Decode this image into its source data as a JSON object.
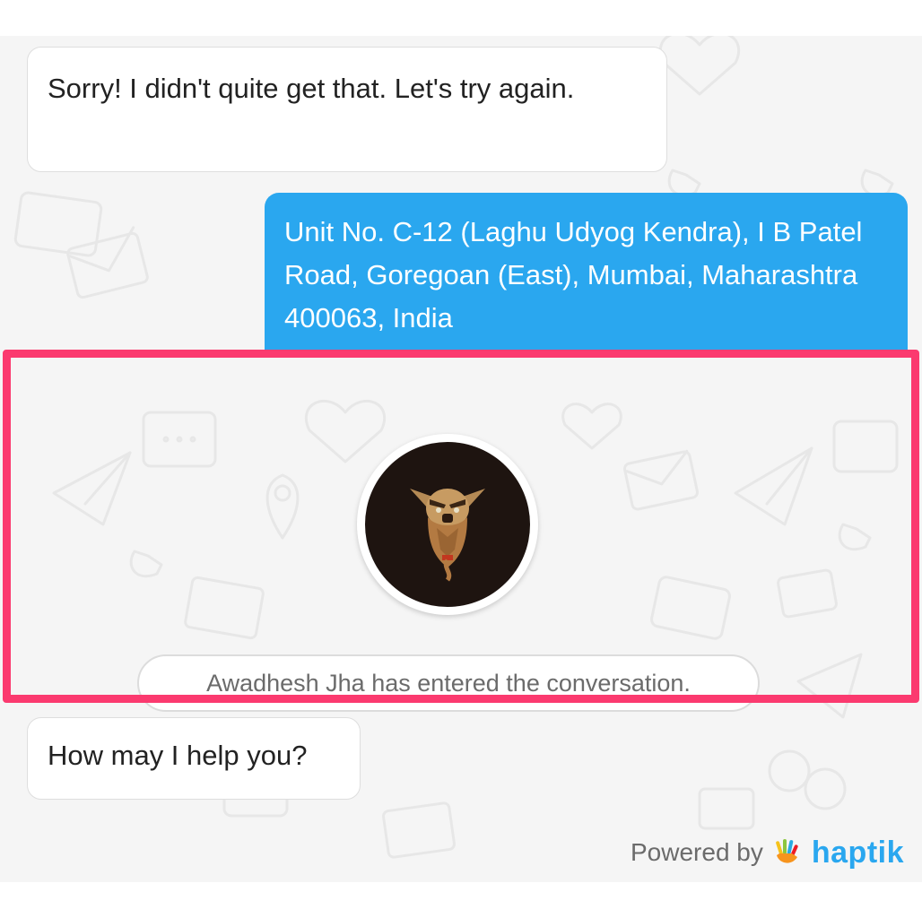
{
  "messages": {
    "bot_retry": "Sorry! I didn't quite get that. Let's try again.",
    "user_address": "Unit No. C-12 (Laghu Udyog Kendra), I B Patel Road, Goregoan (East), Mumbai, Maharashtra 400063, India",
    "bot_help": "How may I help you?"
  },
  "agent": {
    "avatar_icon": "bearded-warrior-avatar",
    "join_notice": "Awadhesh Jha has entered the conversation."
  },
  "footer": {
    "powered_by": "Powered by",
    "brand_name": "haptik",
    "brand_icon": "hand-logo-icon"
  },
  "colors": {
    "user_bubble": "#2aa7ef",
    "highlight": "#fb3a6f",
    "brand": "#2aa7ef"
  }
}
